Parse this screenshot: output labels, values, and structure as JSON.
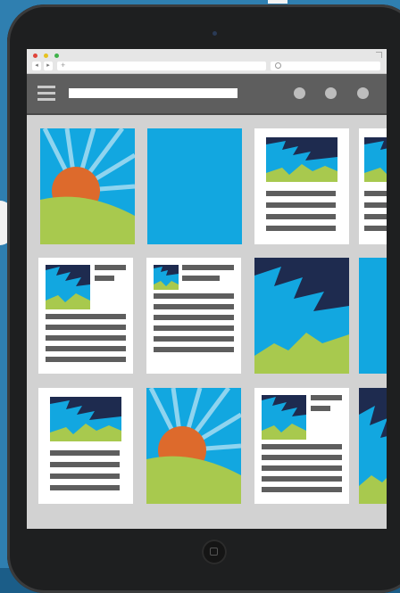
{
  "window": {
    "title": "",
    "url": "",
    "search": ""
  },
  "toolbar": {
    "menu_icon": "hamburger-menu-icon",
    "action_icons": [
      "circle-icon",
      "circle-icon",
      "circle-icon"
    ]
  },
  "colors": {
    "sky": "#12a7e0",
    "navy": "#1e2b4f",
    "grass": "#a8c94e",
    "sun": "#dd6a2c",
    "text_line": "#5e5e5e",
    "appbar": "#5e5e5e",
    "page_bg": "#d2d2d2"
  },
  "cards": [
    {
      "type": "sunset-image"
    },
    {
      "type": "solid-blue"
    },
    {
      "type": "image-top-article"
    },
    {
      "type": "image-top-article"
    },
    {
      "type": "image-left-article"
    },
    {
      "type": "image-left-article"
    },
    {
      "type": "mountain-image"
    },
    {
      "type": "solid-blue"
    },
    {
      "type": "image-top-article"
    },
    {
      "type": "sunset-image"
    },
    {
      "type": "image-left-article"
    },
    {
      "type": "mountain-image"
    }
  ]
}
